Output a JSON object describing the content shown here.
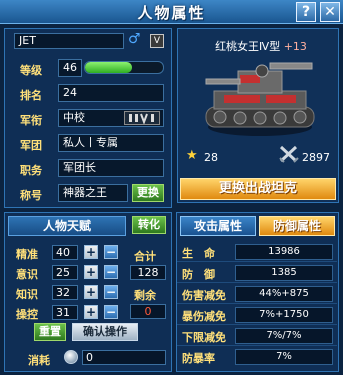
{
  "window": {
    "title": "人物属性",
    "help_label": "?",
    "close_label": "✕"
  },
  "profile": {
    "name": "JET",
    "gender_symbol": "♂",
    "rank_badge": "V",
    "rows": [
      {
        "label": "等级",
        "value": "46"
      },
      {
        "label": "排名",
        "value": "24"
      },
      {
        "label": "军衔",
        "value": "中校"
      },
      {
        "label": "军团",
        "value": "私人丨专属"
      },
      {
        "label": "职务",
        "value": "军团长"
      },
      {
        "label": "称号",
        "value": "神器之王"
      }
    ],
    "level_progress": 0.6,
    "title_change_label": "更换"
  },
  "tank": {
    "name": "红桃女王Ⅳ型",
    "plus": "+13",
    "stars": "28",
    "power": "2897",
    "change_button_label": "更换出战坦克"
  },
  "talent": {
    "header": "人物天赋",
    "switch_label": "转化",
    "stats": [
      {
        "label": "精准",
        "value": "40"
      },
      {
        "label": "意识",
        "value": "25"
      },
      {
        "label": "知识",
        "value": "32"
      },
      {
        "label": "操控",
        "value": "31"
      }
    ],
    "total_label": "合计",
    "total_value": "128",
    "remaining_label": "剩余",
    "remaining_value": "0",
    "reset_label": "重置",
    "confirm_label": "确认操作",
    "consume_label": "消耗",
    "consume_value": "0"
  },
  "attributes": {
    "attack_tab": "攻击属性",
    "defense_tab": "防御属性",
    "rows": [
      {
        "label": "生　命",
        "value": "13986"
      },
      {
        "label": "防　御",
        "value": "1385"
      },
      {
        "label": "伤害减免",
        "value": "44%+875"
      },
      {
        "label": "暴伤减免",
        "value": "7%+1750"
      },
      {
        "label": "下限减免",
        "value": "7%/7%"
      },
      {
        "label": "防暴率",
        "value": "7%"
      }
    ]
  },
  "colors": {
    "accent": "#ffe07a",
    "progress": "#4fd24a",
    "orange_button": "#f0a020"
  }
}
